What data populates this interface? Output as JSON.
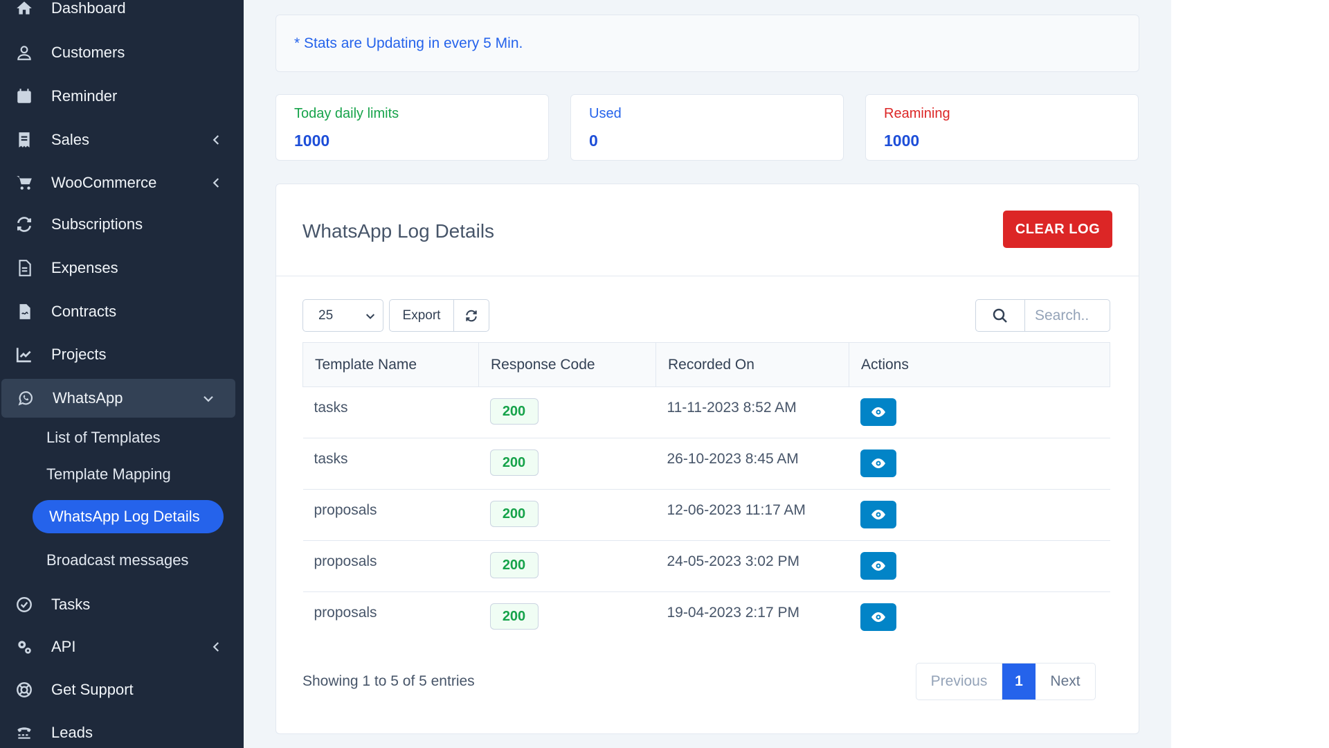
{
  "sidebar": {
    "items": [
      {
        "label": "Dashboard",
        "icon": "home-icon",
        "has_chevron": false
      },
      {
        "label": "Customers",
        "icon": "user-icon",
        "has_chevron": false
      },
      {
        "label": "Reminder",
        "icon": "calendar-icon",
        "has_chevron": false
      },
      {
        "label": "Sales",
        "icon": "receipt-icon",
        "has_chevron": true
      },
      {
        "label": "WooCommerce",
        "icon": "cart-icon",
        "has_chevron": true
      },
      {
        "label": "Subscriptions",
        "icon": "repeat-icon",
        "has_chevron": false
      },
      {
        "label": "Expenses",
        "icon": "document-icon",
        "has_chevron": false
      },
      {
        "label": "Contracts",
        "icon": "contract-icon",
        "has_chevron": false
      },
      {
        "label": "Projects",
        "icon": "chart-icon",
        "has_chevron": false
      },
      {
        "label": "WhatsApp",
        "icon": "whatsapp-icon",
        "has_chevron": true,
        "expanded": true
      },
      {
        "label": "Tasks",
        "icon": "check-circle-icon",
        "has_chevron": false
      },
      {
        "label": "API",
        "icon": "cogs-icon",
        "has_chevron": true
      },
      {
        "label": "Get Support",
        "icon": "lifebuoy-icon",
        "has_chevron": false
      },
      {
        "label": "Leads",
        "icon": "tty-icon",
        "has_chevron": false
      }
    ],
    "whatsapp_sub": [
      {
        "label": "List of Templates",
        "active": false
      },
      {
        "label": "Template Mapping",
        "active": false
      },
      {
        "label": "WhatsApp Log Details",
        "active": true
      },
      {
        "label": "Broadcast messages",
        "active": false
      }
    ]
  },
  "notice": "* Stats are Updating in every 5 Min.",
  "stats": [
    {
      "label": "Today daily limits",
      "value": "1000",
      "color": "#16a34a"
    },
    {
      "label": "Used",
      "value": "0",
      "color": "#2563eb"
    },
    {
      "label": "Reamining",
      "value": "1000",
      "color": "#dc2626"
    }
  ],
  "card": {
    "title": "WhatsApp Log Details",
    "clear_label": "CLEAR LOG"
  },
  "toolbar": {
    "page_size": "25",
    "export_label": "Export",
    "search_placeholder": "Search.."
  },
  "table": {
    "headers": [
      "Template Name",
      "Response Code",
      "Recorded On",
      "Actions"
    ],
    "rows": [
      {
        "template": "tasks",
        "code": "200",
        "recorded": "11-11-2023 8:52 AM"
      },
      {
        "template": "tasks",
        "code": "200",
        "recorded": "26-10-2023 8:45 AM"
      },
      {
        "template": "proposals",
        "code": "200",
        "recorded": "12-06-2023 11:17 AM"
      },
      {
        "template": "proposals",
        "code": "200",
        "recorded": "24-05-2023 3:02 PM"
      },
      {
        "template": "proposals",
        "code": "200",
        "recorded": "19-04-2023 2:17 PM"
      }
    ]
  },
  "footer": {
    "entries": "Showing 1 to 5 of 5 entries",
    "prev": "Previous",
    "page": "1",
    "next": "Next"
  },
  "colors": {
    "sidebar_bg": "#1e293b",
    "accent": "#2563eb",
    "danger": "#dc2626",
    "success": "#16a34a",
    "view_button": "#0284c7"
  }
}
